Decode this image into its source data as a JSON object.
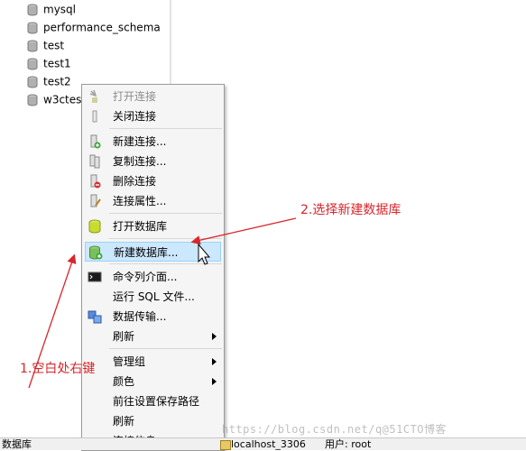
{
  "tree": {
    "items": [
      {
        "label": "mysql"
      },
      {
        "label": "performance_schema"
      },
      {
        "label": "test"
      },
      {
        "label": "test1"
      },
      {
        "label": "test2"
      },
      {
        "label": "w3ctes"
      }
    ]
  },
  "context_menu": {
    "items": [
      {
        "label": "打开连接",
        "icon": "open-connection-icon",
        "disabled": true
      },
      {
        "label": "关闭连接",
        "icon": "close-connection-icon"
      },
      {
        "label": "新建连接...",
        "icon": "new-connection-icon"
      },
      {
        "label": "复制连接...",
        "icon": "copy-connection-icon"
      },
      {
        "label": "删除连接",
        "icon": "delete-connection-icon"
      },
      {
        "label": "连接属性...",
        "icon": "connection-properties-icon"
      },
      {
        "label": "打开数据库",
        "icon": "open-database-icon"
      },
      {
        "label": "新建数据库...",
        "icon": "new-database-icon",
        "highlighted": true
      },
      {
        "label": "命令列介面...",
        "icon": "console-icon"
      },
      {
        "label": "运行 SQL 文件..."
      },
      {
        "label": "数据传输...",
        "icon": "data-transfer-icon"
      },
      {
        "label": "刷新",
        "submenu": true
      },
      {
        "label": "管理组",
        "submenu": true
      },
      {
        "label": "颜色",
        "submenu": true
      },
      {
        "label": "前往设置保存路径"
      },
      {
        "label": "刷新"
      },
      {
        "label": "连接信息..."
      }
    ]
  },
  "annotations": {
    "step1": "1.空白处右键",
    "step2": "2.选择新建数据库"
  },
  "statusbar": {
    "left": "数据库",
    "connection": "localhost_3306",
    "user": "用户: root"
  },
  "watermark": "https://blog.csdn.net/q@51CTO博客",
  "colors": {
    "highlight": "#cce8ff",
    "annotation": "#d8262b"
  }
}
